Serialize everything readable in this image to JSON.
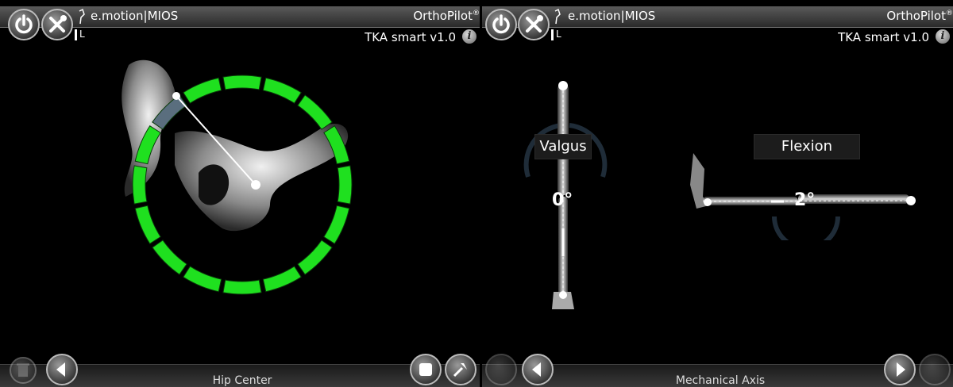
{
  "left_panel": {
    "app_title": "e.motion|MIOS",
    "brand": "OrthoPilot",
    "brand_mark": "®",
    "version": "TKA smart v1.0",
    "info_glyph": "i",
    "side": "L",
    "step_title": "Hip Center",
    "ring": {
      "segments_total": 16,
      "segments_done": 15,
      "pending_index": 15,
      "done_color": "#1fe01f",
      "pending_color": "#5a6e7e"
    },
    "icons": {
      "power": "power-icon",
      "tools": "tools-icon",
      "delete": "trash-icon",
      "back": "back-icon",
      "stop": "stop-icon",
      "pointer": "pointer-icon"
    }
  },
  "right_panel": {
    "app_title": "e.motion|MIOS",
    "brand": "OrthoPilot",
    "brand_mark": "®",
    "version": "TKA smart v1.0",
    "info_glyph": "i",
    "side": "L",
    "step_title": "Mechanical Axis",
    "valgus": {
      "label": "Valgus",
      "value": "0°"
    },
    "flexion": {
      "label": "Flexion",
      "value": "2°"
    },
    "icons": {
      "power": "power-icon",
      "tools": "tools-icon",
      "back": "back-icon",
      "forward": "forward-icon"
    }
  }
}
